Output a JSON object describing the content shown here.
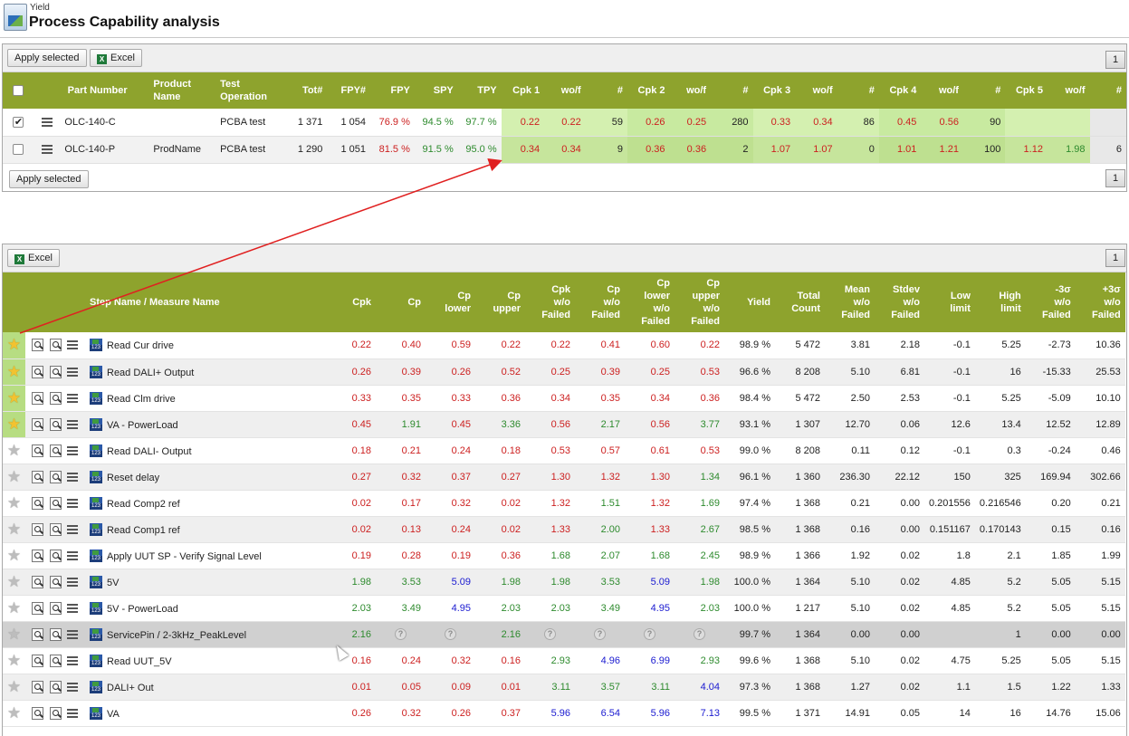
{
  "header": {
    "subtitle": "Yield",
    "title": "Process Capability analysis"
  },
  "panel1": {
    "apply_label": "Apply selected",
    "excel_label": "Excel",
    "page_label": "1",
    "columns": [
      "",
      "Part Number",
      "Product Name",
      "Test Operation",
      "Tot#",
      "FPY#",
      "FPY",
      "SPY",
      "TPY",
      "Cpk 1",
      "wo/f",
      "#",
      "Cpk 2",
      "wo/f",
      "#",
      "Cpk 3",
      "wo/f",
      "#",
      "Cpk 4",
      "wo/f",
      "#",
      "Cpk 5",
      "wo/f",
      "#"
    ],
    "rows": [
      {
        "checked": true,
        "cells": [
          "OLC-140-C",
          "",
          "PCBA test",
          "1 371",
          "1 054",
          "76.9 %",
          "94.5 %",
          "97.7 %",
          "0.22",
          "0.22",
          "59",
          "0.26",
          "0.25",
          "280",
          "0.33",
          "0.34",
          "86",
          "0.45",
          "0.56",
          "90",
          "",
          "",
          ""
        ]
      },
      {
        "checked": false,
        "cells": [
          "OLC-140-P",
          "ProdName",
          "PCBA test",
          "1 290",
          "1 051",
          "81.5 %",
          "91.5 %",
          "95.0 %",
          "0.34",
          "0.34",
          "9",
          "0.36",
          "0.36",
          "2",
          "1.07",
          "1.07",
          "0",
          "1.01",
          "1.21",
          "100",
          "1.12",
          "1.98",
          "6"
        ]
      }
    ]
  },
  "panel2": {
    "excel_label": "Excel",
    "page_label": "1",
    "columns": [
      "Step Name / Measure Name",
      "Cpk",
      "Cp",
      "Cp lower",
      "Cp upper",
      "Cpk w/o Failed",
      "Cp w/o Failed",
      "Cp lower w/o Failed",
      "Cp upper w/o Failed",
      "Yield",
      "Total Count",
      "Mean w/o Failed",
      "Stdev w/o Failed",
      "Low limit",
      "High limit",
      "-3σ w/o Failed",
      "+3σ w/o Failed"
    ],
    "rows": [
      {
        "star": true,
        "name": "Read Cur drive",
        "v": [
          "0.22",
          "0.40",
          "0.59",
          "0.22",
          "0.22",
          "0.41",
          "0.60",
          "0.22",
          "98.9 %",
          "5 472",
          "3.81",
          "2.18",
          "-0.1",
          "5.25",
          "-2.73",
          "10.36"
        ],
        "c": [
          "r",
          "r",
          "r",
          "r",
          "r",
          "r",
          "r",
          "r"
        ]
      },
      {
        "star": true,
        "name": "Read DALI+ Output",
        "v": [
          "0.26",
          "0.39",
          "0.26",
          "0.52",
          "0.25",
          "0.39",
          "0.25",
          "0.53",
          "96.6 %",
          "8 208",
          "5.10",
          "6.81",
          "-0.1",
          "16",
          "-15.33",
          "25.53"
        ],
        "c": [
          "r",
          "r",
          "r",
          "r",
          "r",
          "r",
          "r",
          "r"
        ]
      },
      {
        "star": true,
        "name": "Read Clm drive",
        "v": [
          "0.33",
          "0.35",
          "0.33",
          "0.36",
          "0.34",
          "0.35",
          "0.34",
          "0.36",
          "98.4 %",
          "5 472",
          "2.50",
          "2.53",
          "-0.1",
          "5.25",
          "-5.09",
          "10.10"
        ],
        "c": [
          "r",
          "r",
          "r",
          "r",
          "r",
          "r",
          "r",
          "r"
        ]
      },
      {
        "star": true,
        "name": "VA - PowerLoad",
        "v": [
          "0.45",
          "1.91",
          "0.45",
          "3.36",
          "0.56",
          "2.17",
          "0.56",
          "3.77",
          "93.1 %",
          "1 307",
          "12.70",
          "0.06",
          "12.6",
          "13.4",
          "12.52",
          "12.89"
        ],
        "c": [
          "r",
          "g",
          "r",
          "g",
          "r",
          "g",
          "r",
          "g"
        ]
      },
      {
        "star": false,
        "name": "Read DALI- Output",
        "v": [
          "0.18",
          "0.21",
          "0.24",
          "0.18",
          "0.53",
          "0.57",
          "0.61",
          "0.53",
          "99.0 %",
          "8 208",
          "0.11",
          "0.12",
          "-0.1",
          "0.3",
          "-0.24",
          "0.46"
        ],
        "c": [
          "r",
          "r",
          "r",
          "r",
          "r",
          "r",
          "r",
          "r"
        ]
      },
      {
        "star": false,
        "name": "Reset delay",
        "v": [
          "0.27",
          "0.32",
          "0.37",
          "0.27",
          "1.30",
          "1.32",
          "1.30",
          "1.34",
          "96.1 %",
          "1 360",
          "236.30",
          "22.12",
          "150",
          "325",
          "169.94",
          "302.66"
        ],
        "c": [
          "r",
          "r",
          "r",
          "r",
          "r",
          "r",
          "r",
          "g"
        ]
      },
      {
        "star": false,
        "name": "Read Comp2 ref",
        "v": [
          "0.02",
          "0.17",
          "0.32",
          "0.02",
          "1.32",
          "1.51",
          "1.32",
          "1.69",
          "97.4 %",
          "1 368",
          "0.21",
          "0.00",
          "0.201556",
          "0.216546",
          "0.20",
          "0.21"
        ],
        "c": [
          "r",
          "r",
          "r",
          "r",
          "r",
          "g",
          "r",
          "g"
        ]
      },
      {
        "star": false,
        "name": "Read Comp1 ref",
        "v": [
          "0.02",
          "0.13",
          "0.24",
          "0.02",
          "1.33",
          "2.00",
          "1.33",
          "2.67",
          "98.5 %",
          "1 368",
          "0.16",
          "0.00",
          "0.151167",
          "0.170143",
          "0.15",
          "0.16"
        ],
        "c": [
          "r",
          "r",
          "r",
          "r",
          "r",
          "g",
          "r",
          "g"
        ]
      },
      {
        "star": false,
        "name": "Apply UUT SP - Verify Signal Level",
        "v": [
          "0.19",
          "0.28",
          "0.19",
          "0.36",
          "1.68",
          "2.07",
          "1.68",
          "2.45",
          "98.9 %",
          "1 366",
          "1.92",
          "0.02",
          "1.8",
          "2.1",
          "1.85",
          "1.99"
        ],
        "c": [
          "r",
          "r",
          "r",
          "r",
          "g",
          "g",
          "g",
          "g"
        ]
      },
      {
        "star": false,
        "name": "5V",
        "v": [
          "1.98",
          "3.53",
          "5.09",
          "1.98",
          "1.98",
          "3.53",
          "5.09",
          "1.98",
          "100.0 %",
          "1 364",
          "5.10",
          "0.02",
          "4.85",
          "5.2",
          "5.05",
          "5.15"
        ],
        "c": [
          "g",
          "g",
          "b",
          "g",
          "g",
          "g",
          "b",
          "g"
        ]
      },
      {
        "star": false,
        "name": "5V - PowerLoad",
        "v": [
          "2.03",
          "3.49",
          "4.95",
          "2.03",
          "2.03",
          "3.49",
          "4.95",
          "2.03",
          "100.0 %",
          "1 217",
          "5.10",
          "0.02",
          "4.85",
          "5.2",
          "5.05",
          "5.15"
        ],
        "c": [
          "g",
          "g",
          "b",
          "g",
          "g",
          "g",
          "b",
          "g"
        ]
      },
      {
        "star": false,
        "name": "ServicePin / 2-3kHz_PeakLevel",
        "v": [
          "2.16",
          "?",
          "?",
          "2.16",
          "?",
          "?",
          "?",
          "?",
          "99.7 %",
          "1 364",
          "0.00",
          "0.00",
          "",
          "1",
          "0.00",
          "0.00"
        ],
        "c": [
          "g",
          "q",
          "q",
          "g",
          "q",
          "q",
          "q",
          "q"
        ]
      },
      {
        "star": false,
        "name": "Read UUT_5V",
        "v": [
          "0.16",
          "0.24",
          "0.32",
          "0.16",
          "2.93",
          "4.96",
          "6.99",
          "2.93",
          "99.6 %",
          "1 368",
          "5.10",
          "0.02",
          "4.75",
          "5.25",
          "5.05",
          "5.15"
        ],
        "c": [
          "r",
          "r",
          "r",
          "r",
          "g",
          "b",
          "b",
          "g"
        ]
      },
      {
        "star": false,
        "name": "DALI+ Out",
        "v": [
          "0.01",
          "0.05",
          "0.09",
          "0.01",
          "3.11",
          "3.57",
          "3.11",
          "4.04",
          "97.3 %",
          "1 368",
          "1.27",
          "0.02",
          "1.1",
          "1.5",
          "1.22",
          "1.33"
        ],
        "c": [
          "r",
          "r",
          "r",
          "r",
          "g",
          "g",
          "g",
          "b"
        ]
      },
      {
        "star": false,
        "name": "VA",
        "v": [
          "0.26",
          "0.32",
          "0.26",
          "0.37",
          "5.96",
          "6.54",
          "5.96",
          "7.13",
          "99.5 %",
          "1 371",
          "14.91",
          "0.05",
          "14",
          "16",
          "14.76",
          "15.06"
        ],
        "c": [
          "r",
          "r",
          "r",
          "r",
          "b",
          "b",
          "b",
          "b"
        ]
      }
    ]
  },
  "colors": {
    "header_green": "#8ea32d",
    "highlight_green": "#c4e6a0",
    "bad": "#cc1f1f",
    "ok": "#2d8a2d",
    "great": "#1a1ad0",
    "arrow": "#e02020"
  }
}
